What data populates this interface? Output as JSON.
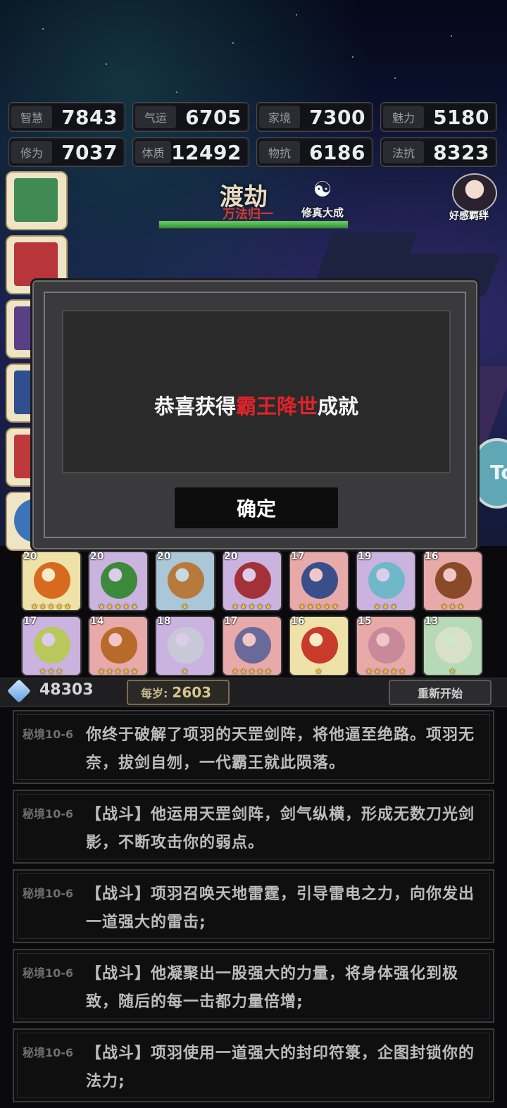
{
  "stats": [
    {
      "label": "智慧",
      "value": "7843"
    },
    {
      "label": "气运",
      "value": "6705"
    },
    {
      "label": "家境",
      "value": "7300"
    },
    {
      "label": "魅力",
      "value": "5180"
    },
    {
      "label": "修为",
      "value": "7037"
    },
    {
      "label": "体质",
      "value": "12492"
    },
    {
      "label": "物抗",
      "value": "6186"
    },
    {
      "label": "法抗",
      "value": "8323"
    }
  ],
  "header": {
    "stage": "渡劫",
    "sub_stage": "万法归一",
    "status": "修真大成",
    "affinity": "好感羁绊",
    "side_button": "To"
  },
  "modal": {
    "msg_prefix": "恭喜获得",
    "msg_highlight": "霸王降世",
    "msg_suffix": "成就",
    "ok_label": "确定"
  },
  "items": [
    {
      "level": "20",
      "stars": 5
    },
    {
      "level": "20",
      "stars": 5
    },
    {
      "level": "20",
      "stars": 1
    },
    {
      "level": "20",
      "stars": 5
    },
    {
      "level": "17",
      "stars": 5
    },
    {
      "level": "19",
      "stars": 3
    },
    {
      "level": "16",
      "stars": 3
    },
    {
      "level": "17",
      "stars": 3
    },
    {
      "level": "14",
      "stars": 5
    },
    {
      "level": "18",
      "stars": 1
    },
    {
      "level": "17",
      "stars": 5
    },
    {
      "level": "16",
      "stars": 1
    },
    {
      "level": "15",
      "stars": 5
    },
    {
      "level": "13",
      "stars": 1
    }
  ],
  "resources": {
    "coins": "48303",
    "per_year_label": "每岁:",
    "per_year_value": "2603",
    "restart_label": "重新开始"
  },
  "log": [
    {
      "tag": "秘境10-6",
      "text": "你终于破解了项羽的天罡剑阵，将他逼至绝路。项羽无奈，拔剑自刎，一代霸王就此陨落。"
    },
    {
      "tag": "秘境10-6",
      "text": "【战斗】他运用天罡剑阵，剑气纵横，形成无数刀光剑影，不断攻击你的弱点。"
    },
    {
      "tag": "秘境10-6",
      "text": "【战斗】项羽召唤天地雷霆，引导雷电之力，向你发出一道强大的雷击;"
    },
    {
      "tag": "秘境10-6",
      "text": "【战斗】他凝聚出一股强大的力量，将身体强化到极致，随后的每一击都力量倍增;"
    },
    {
      "tag": "秘境10-6",
      "text": "【战斗】项羽使用一道强大的封印符箓，企图封锁你的法力;"
    }
  ],
  "colors": {
    "highlight_red": "#e0232a",
    "sub_stage_red": "#e0392c",
    "hp_green": "#4caf50",
    "star_gold": "#f0c23a"
  },
  "progress": {
    "hp_fraction": 1.0
  }
}
